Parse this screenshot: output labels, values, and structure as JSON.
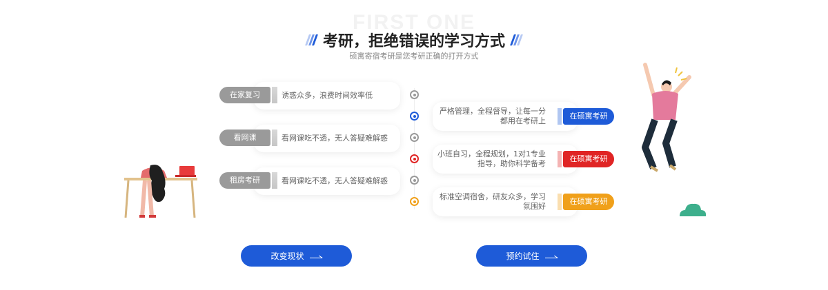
{
  "header": {
    "watermark": "FIRST ONE",
    "title": "考研，拒绝错误的学习方式",
    "subtitle": "硕寓寄宿考研是您考研正确的打开方式"
  },
  "left_items": [
    {
      "tag": "在家复习",
      "text": "诱惑众多，浪费时间效率低"
    },
    {
      "tag": "看网课",
      "text": "看网课吃不透，无人答疑难解惑"
    },
    {
      "tag": "租房考研",
      "text": "看网课吃不透，无人答疑难解惑"
    }
  ],
  "right_items": [
    {
      "line1": "严格管理，全程督导，让每一分",
      "line2": "都用在考研上",
      "tag": "在硕寓考研",
      "color": "#1e5bd8"
    },
    {
      "line1": "小班自习，全程规划，1对1专业",
      "line2": "指导，助你科学备考",
      "tag": "在硕寓考研",
      "color": "#e02424"
    },
    {
      "line1": "标准空调宿舍，研友众多，学习",
      "line2": "氛围好",
      "tag": "在硕寓考研",
      "color": "#f0a01a"
    }
  ],
  "buttons": {
    "change": "改变现状",
    "trial": "预约试住"
  },
  "icons": [
    "slash-decoration-icon",
    "timeline-dot-icon",
    "arrow-right-icon"
  ]
}
